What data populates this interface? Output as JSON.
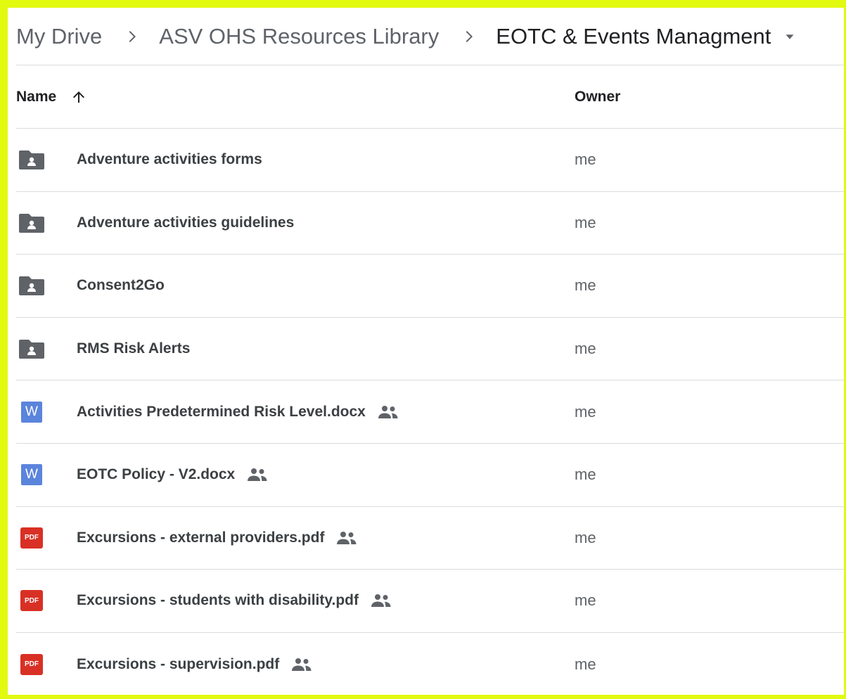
{
  "breadcrumb": {
    "items": [
      "My Drive",
      "ASV OHS Resources Library",
      "EOTC & Events Managment"
    ]
  },
  "header": {
    "name_label": "Name",
    "owner_label": "Owner",
    "sort": "ascending"
  },
  "files": [
    {
      "name": "Adventure activities forms",
      "type": "shared-folder",
      "icon": "folder-shared-icon",
      "shared": false,
      "owner": "me"
    },
    {
      "name": "Adventure activities guidelines",
      "type": "shared-folder",
      "icon": "folder-shared-icon",
      "shared": false,
      "owner": "me"
    },
    {
      "name": "Consent2Go",
      "type": "shared-folder",
      "icon": "folder-shared-icon",
      "shared": false,
      "owner": "me"
    },
    {
      "name": "RMS Risk Alerts",
      "type": "shared-folder",
      "icon": "folder-shared-icon",
      "shared": false,
      "owner": "me"
    },
    {
      "name": "Activities Predetermined Risk Level.docx",
      "type": "word",
      "icon": "word-doc-icon",
      "badge": "W",
      "shared": true,
      "owner": "me"
    },
    {
      "name": "EOTC Policy - V2.docx",
      "type": "word",
      "icon": "word-doc-icon",
      "badge": "W",
      "shared": true,
      "owner": "me"
    },
    {
      "name": "Excursions - external providers.pdf",
      "type": "pdf",
      "icon": "pdf-icon",
      "badge": "PDF",
      "shared": true,
      "owner": "me"
    },
    {
      "name": "Excursions - students with disability.pdf",
      "type": "pdf",
      "icon": "pdf-icon",
      "badge": "PDF",
      "shared": true,
      "owner": "me"
    },
    {
      "name": "Excursions - supervision.pdf",
      "type": "pdf",
      "icon": "pdf-icon",
      "badge": "PDF",
      "shared": true,
      "owner": "me"
    }
  ],
  "colors": {
    "frame_highlight": "#e2fa10",
    "folder_icon": "#5f6368",
    "word_blue": "#5b84dc",
    "pdf_red": "#d93025",
    "divider": "#dadce0"
  }
}
